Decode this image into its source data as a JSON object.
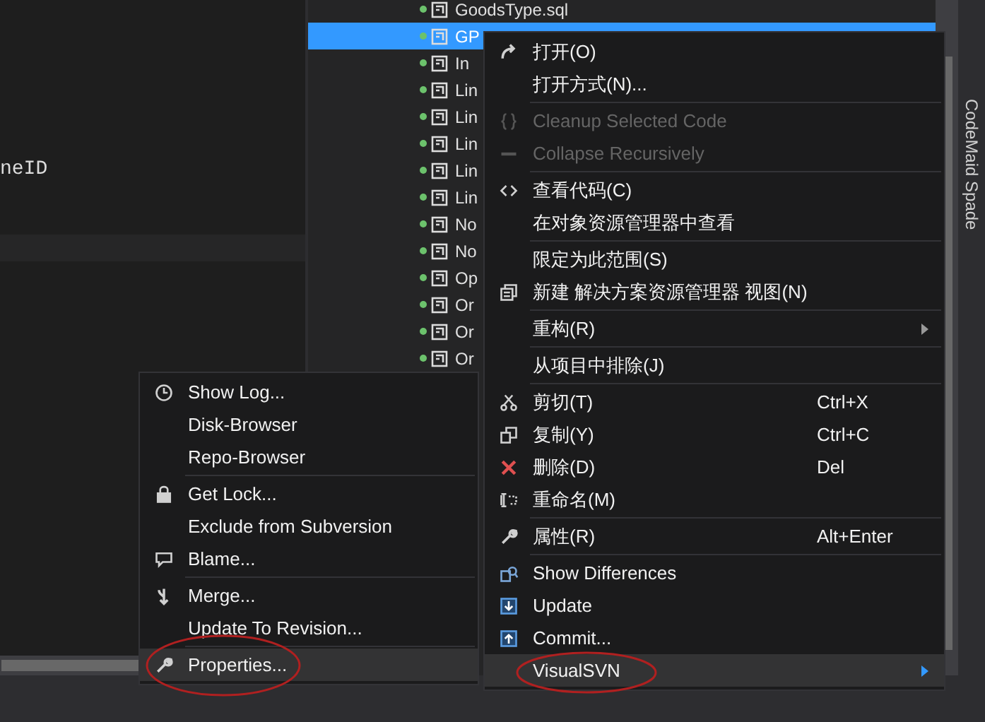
{
  "editor": {
    "code_line": "neID"
  },
  "solution_explorer": {
    "items": [
      {
        "label": "GoodsType.sql",
        "selected": false
      },
      {
        "label": "GP",
        "selected": true
      },
      {
        "label": "In",
        "selected": false
      },
      {
        "label": "Lin",
        "selected": false
      },
      {
        "label": "Lin",
        "selected": false
      },
      {
        "label": "Lin",
        "selected": false
      },
      {
        "label": "Lin",
        "selected": false
      },
      {
        "label": "Lin",
        "selected": false
      },
      {
        "label": "No",
        "selected": false
      },
      {
        "label": "No",
        "selected": false
      },
      {
        "label": "Op",
        "selected": false
      },
      {
        "label": "Or",
        "selected": false
      },
      {
        "label": "Or",
        "selected": false
      },
      {
        "label": "Or",
        "selected": false
      }
    ]
  },
  "side_tab": {
    "label": "CodeMaid Spade"
  },
  "context_menu": {
    "items": [
      {
        "kind": "item",
        "label": "打开(O)",
        "disabled": false,
        "selected": false
      },
      {
        "kind": "item",
        "label": "打开方式(N)...",
        "disabled": false,
        "selected": false
      },
      {
        "kind": "separator"
      },
      {
        "kind": "item",
        "label": "Cleanup Selected Code",
        "disabled": true,
        "selected": false
      },
      {
        "kind": "item",
        "label": "Collapse Recursively",
        "disabled": true,
        "selected": false
      },
      {
        "kind": "separator"
      },
      {
        "kind": "item",
        "label": "查看代码(C)",
        "disabled": false,
        "selected": false
      },
      {
        "kind": "item",
        "label": "在对象资源管理器中查看",
        "disabled": false,
        "selected": false
      },
      {
        "kind": "separator"
      },
      {
        "kind": "item",
        "label": "限定为此范围(S)",
        "disabled": false,
        "selected": false
      },
      {
        "kind": "item",
        "label": "新建 解决方案资源管理器 视图(N)",
        "disabled": false,
        "selected": false
      },
      {
        "kind": "separator"
      },
      {
        "kind": "submenu",
        "label": "重构(R)",
        "disabled": false,
        "selected": false
      },
      {
        "kind": "separator"
      },
      {
        "kind": "item",
        "label": "从项目中排除(J)",
        "disabled": false,
        "selected": false
      },
      {
        "kind": "separator"
      },
      {
        "kind": "item",
        "label": "剪切(T)",
        "shortcut": "Ctrl+X",
        "disabled": false,
        "selected": false
      },
      {
        "kind": "item",
        "label": "复制(Y)",
        "shortcut": "Ctrl+C",
        "disabled": false,
        "selected": false
      },
      {
        "kind": "item",
        "label": "删除(D)",
        "shortcut": "Del",
        "disabled": false,
        "selected": false
      },
      {
        "kind": "item",
        "label": "重命名(M)",
        "disabled": false,
        "selected": false
      },
      {
        "kind": "separator"
      },
      {
        "kind": "item",
        "label": "属性(R)",
        "shortcut": "Alt+Enter",
        "disabled": false,
        "selected": false
      },
      {
        "kind": "separator"
      },
      {
        "kind": "item",
        "label": "Show Differences",
        "disabled": false,
        "selected": false
      },
      {
        "kind": "item",
        "label": "Update",
        "disabled": false,
        "selected": false
      },
      {
        "kind": "item",
        "label": "Commit...",
        "disabled": false,
        "selected": false
      },
      {
        "kind": "submenu",
        "label": "VisualSVN",
        "disabled": false,
        "selected": true
      }
    ]
  },
  "submenu": {
    "items": [
      {
        "kind": "item",
        "label": "Show Log...",
        "selected": false
      },
      {
        "kind": "item",
        "label": "Disk-Browser",
        "selected": false
      },
      {
        "kind": "item",
        "label": "Repo-Browser",
        "selected": false
      },
      {
        "kind": "separator"
      },
      {
        "kind": "item",
        "label": "Get Lock...",
        "selected": false
      },
      {
        "kind": "item",
        "label": "Exclude from Subversion",
        "selected": false
      },
      {
        "kind": "item",
        "label": "Blame...",
        "selected": false
      },
      {
        "kind": "separator"
      },
      {
        "kind": "item",
        "label": "Merge...",
        "selected": false
      },
      {
        "kind": "item",
        "label": "Update To Revision...",
        "selected": false
      },
      {
        "kind": "separator"
      },
      {
        "kind": "item",
        "label": "Properties...",
        "selected": true
      }
    ]
  }
}
